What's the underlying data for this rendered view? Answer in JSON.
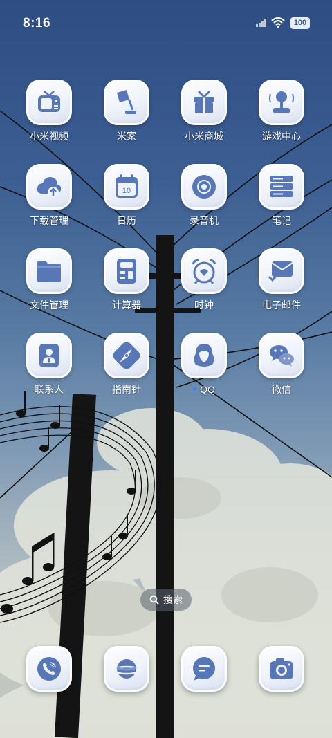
{
  "status_bar": {
    "time": "8:16",
    "battery": "100",
    "signal_icon": "cellular-signal-icon",
    "wifi_icon": "wifi-icon"
  },
  "colors": {
    "icon_accent": "#5877b6",
    "icon_base": "#eef2fa",
    "label": "#ffffff",
    "notification_dot": "#3d7cff"
  },
  "apps": [
    {
      "label": "小米视频",
      "icon": "tv-icon"
    },
    {
      "label": "米家",
      "icon": "lamp-icon"
    },
    {
      "label": "小米商城",
      "icon": "gift-icon"
    },
    {
      "label": "游戏中心",
      "icon": "joystick-icon"
    },
    {
      "label": "下载管理",
      "icon": "cloud-upload-icon"
    },
    {
      "label": "日历",
      "icon": "calendar-icon",
      "badge_text": "10"
    },
    {
      "label": "录音机",
      "icon": "recorder-icon"
    },
    {
      "label": "笔记",
      "icon": "notes-icon"
    },
    {
      "label": "文件管理",
      "icon": "folder-icon"
    },
    {
      "label": "计算器",
      "icon": "calculator-icon"
    },
    {
      "label": "时钟",
      "icon": "alarm-clock-icon"
    },
    {
      "label": "电子邮件",
      "icon": "mail-icon"
    },
    {
      "label": "联系人",
      "icon": "contacts-icon"
    },
    {
      "label": "指南针",
      "icon": "compass-icon"
    },
    {
      "label": "QQ",
      "icon": "qq-icon",
      "notification_dot": true
    },
    {
      "label": "微信",
      "icon": "wechat-icon"
    }
  ],
  "search": {
    "label": "搜索",
    "icon": "search-icon"
  },
  "dock": [
    {
      "name": "phone",
      "icon": "phone-icon"
    },
    {
      "name": "browser",
      "icon": "browser-planet-icon"
    },
    {
      "name": "messages",
      "icon": "message-icon"
    },
    {
      "name": "camera",
      "icon": "camera-icon"
    }
  ]
}
